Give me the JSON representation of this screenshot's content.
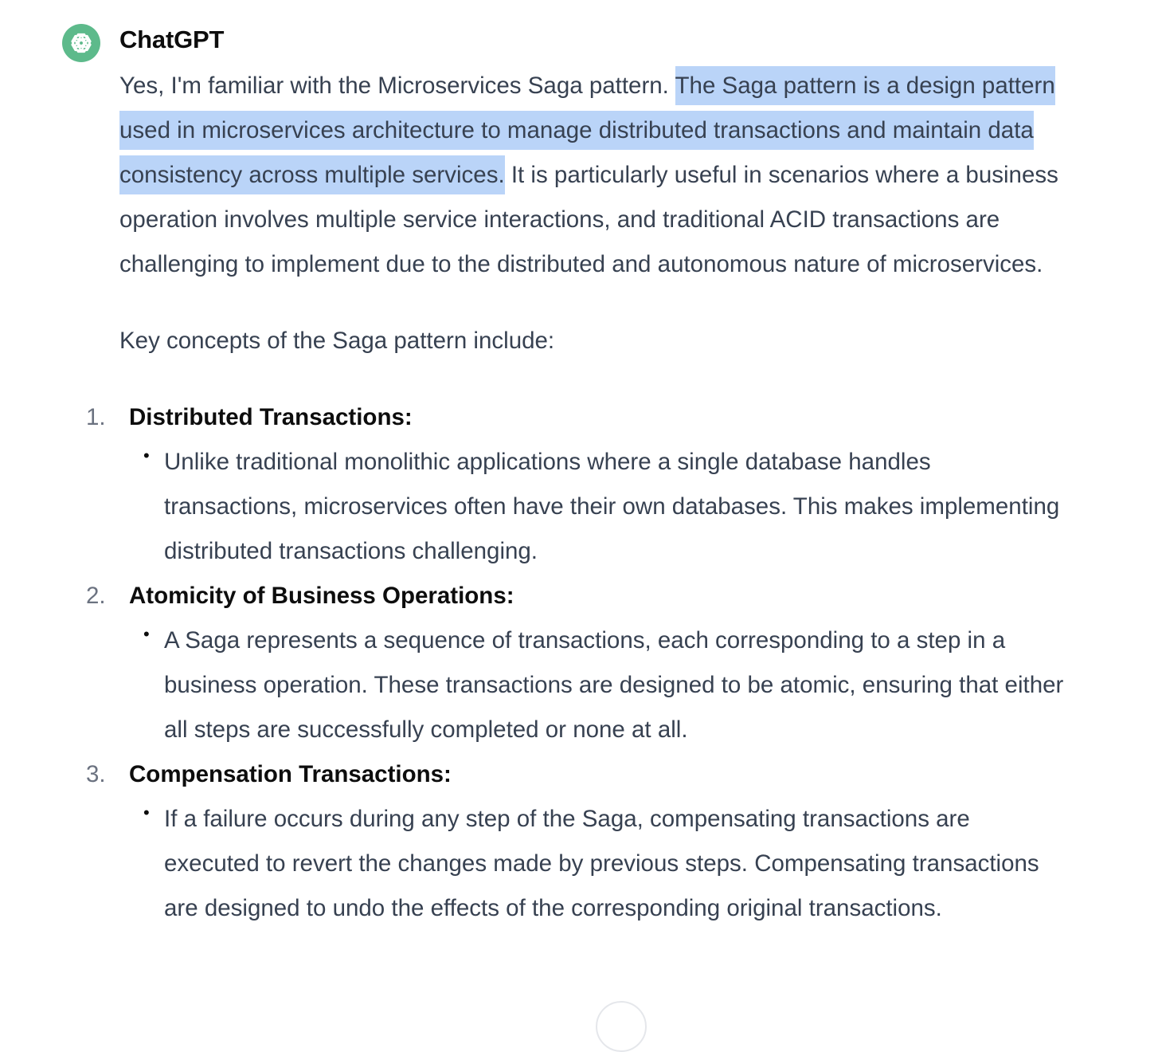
{
  "message": {
    "author": "ChatGPT",
    "avatar_icon": "openai-logo-icon",
    "avatar_color": "#5dba8b",
    "intro": {
      "before_selection": "Yes, I'm familiar with the Microservices Saga pattern. ",
      "selected": "The Saga pattern is a design pattern used in microservices architecture to manage distributed transactions and maintain data consistency across multiple services.",
      "after_selection": " It is particularly useful in scenarios where a business operation involves multiple service interactions, and traditional ACID transactions are challenging to implement due to the distributed and autonomous nature of microservices."
    },
    "selection_color": "#bad4f8",
    "lead": "Key concepts of the Saga pattern include:",
    "concepts": [
      {
        "number": "1.",
        "term": "Distributed Transactions:",
        "point": "Unlike traditional monolithic applications where a single database handles transactions, microservices often have their own databases. This makes implementing distributed transactions challenging."
      },
      {
        "number": "2.",
        "term": "Atomicity of Business Operations:",
        "point": "A Saga represents a sequence of transactions, each corresponding to a step in a business operation. These transactions are designed to be atomic, ensuring that either all steps are successfully completed or none at all."
      },
      {
        "number": "3.",
        "term": "Compensation Transactions:",
        "point": "If a failure occurs during any step of the Saga, compensating transactions are executed to revert the changes made by previous steps. Compensating transactions are designed to undo the effects of the corresponding original transactions."
      }
    ]
  },
  "scroll_button_icon": "scroll-down-icon"
}
